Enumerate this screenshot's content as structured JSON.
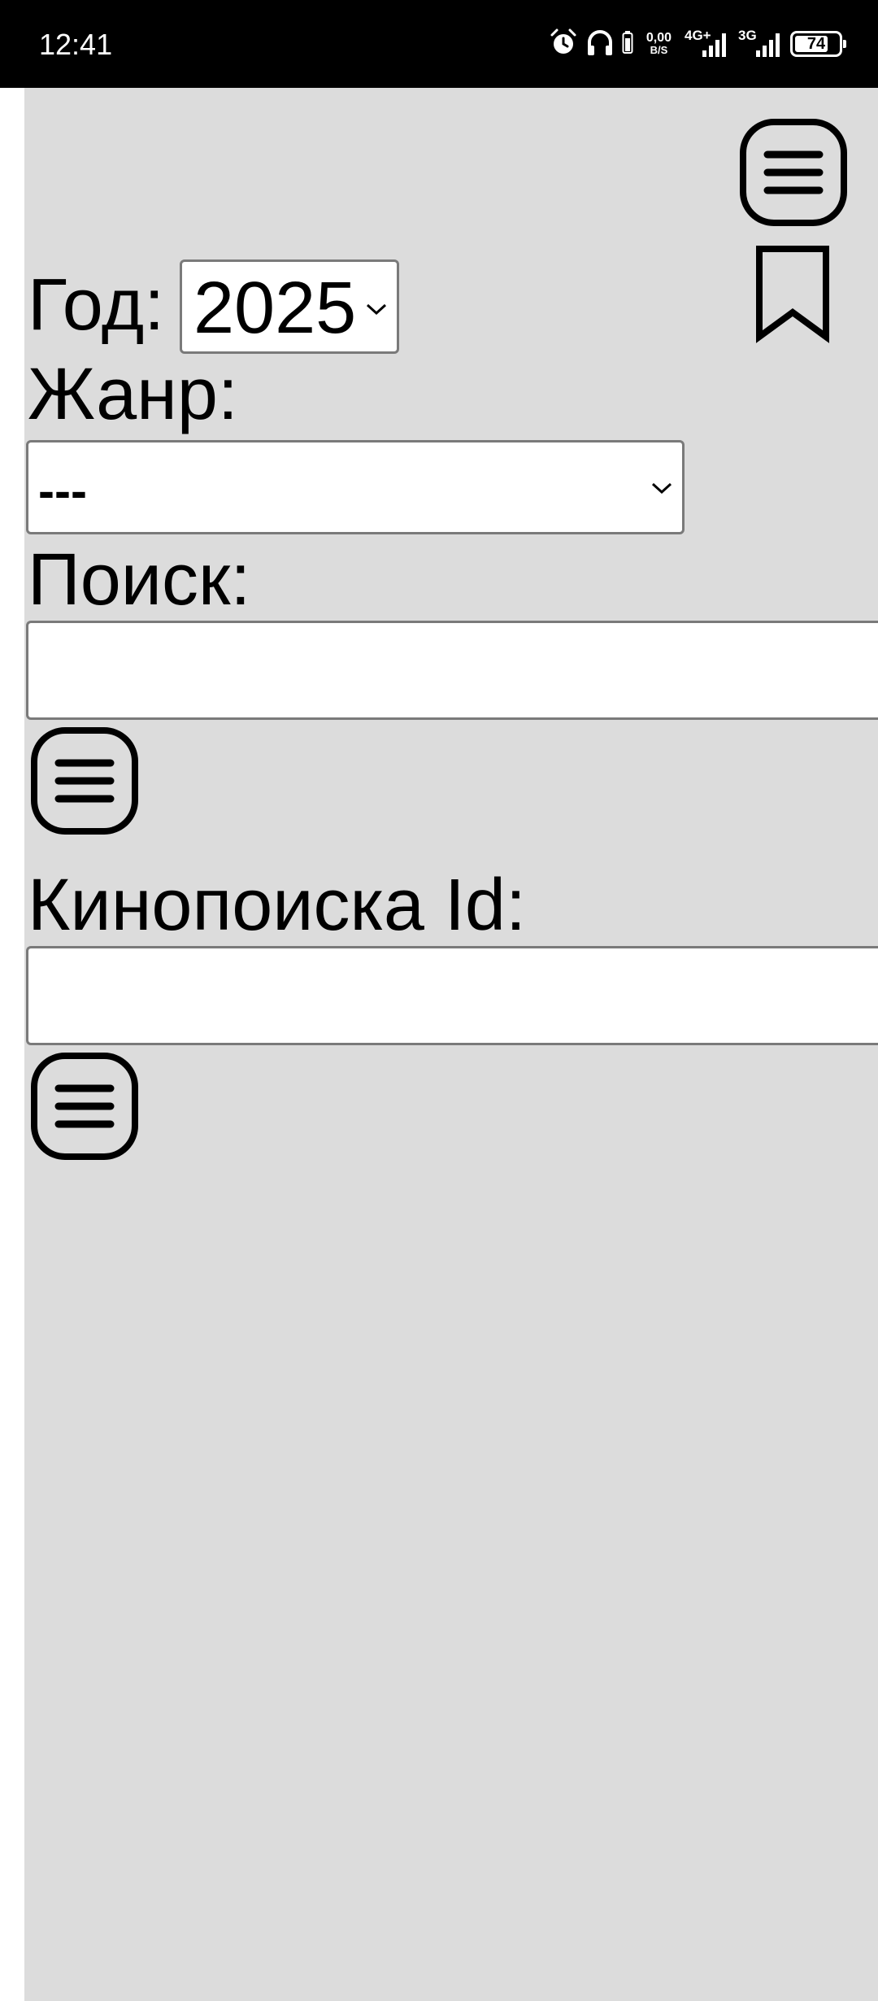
{
  "status_bar": {
    "time": "12:41",
    "net_speed_value": "0,00",
    "net_speed_unit": "B/S",
    "sim1_tech": "4G+",
    "sim2_tech": "3G",
    "battery_level": "74",
    "icons": [
      "alarm-icon",
      "headphones-icon",
      "battery-saver-icon",
      "signal-icon",
      "signal-icon",
      "battery-icon"
    ]
  },
  "toolbar": {
    "menu_icon": "menu-icon",
    "bookmark_icon": "bookmark-icon"
  },
  "filters": {
    "year_label": "Год:",
    "year_value": "2025",
    "genre_label": "Жанр:",
    "genre_value": "---",
    "search_label": "Поиск:",
    "search_value": "",
    "kinopoisk_label": "Кинопоиска Id:",
    "kinopoisk_value": ""
  },
  "colors": {
    "background": "#dcdcdc",
    "status_bar": "#000000",
    "field_border": "#7a7a7a"
  }
}
